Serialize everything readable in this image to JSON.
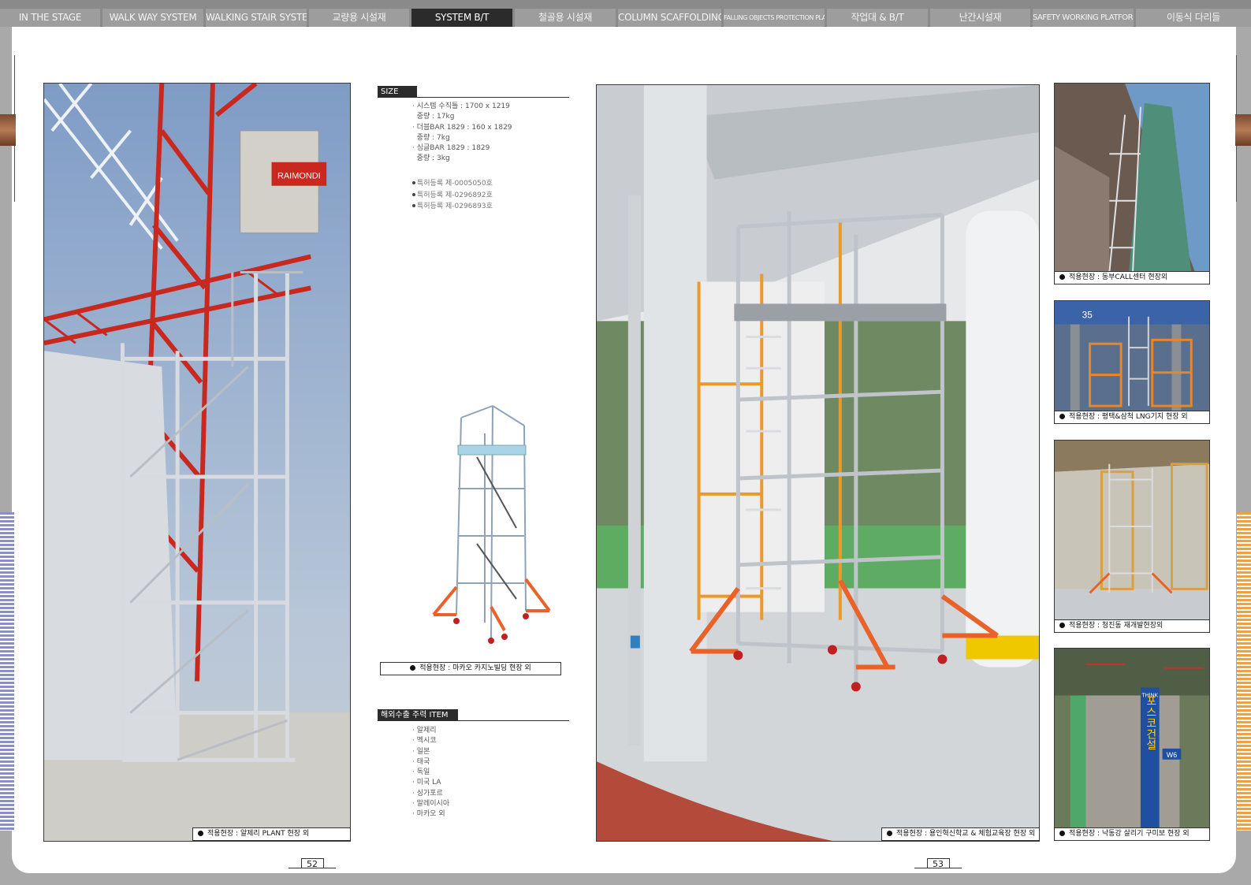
{
  "tabs": [
    {
      "label": "IN THE STAGE",
      "active": false
    },
    {
      "label": "WALK WAY SYSTEM",
      "active": false
    },
    {
      "label": "WALKING STAIR SYSTEM",
      "active": false
    },
    {
      "label": "교량용 시설재",
      "active": false
    },
    {
      "label": "SYSTEM B/T",
      "active": true
    },
    {
      "label": "철골용 시설재",
      "active": false
    },
    {
      "label": "COLUMN SCAFFOLDING",
      "active": false
    },
    {
      "label": "FALLING OBJECTS PROTECTION PLATFORM",
      "active": false
    },
    {
      "label": "작업대 & B/T",
      "active": false
    },
    {
      "label": "난간시설재",
      "active": false
    },
    {
      "label": "SAFETY WORKING PLATFORM",
      "active": false
    },
    {
      "label": "이동식 다리들",
      "active": false
    }
  ],
  "left_page": {
    "main_photo": {
      "icon": "scaffold-tower-crane-photo",
      "caption": "적용현장 : 알제리 PLANT 현장 외"
    },
    "size_section": {
      "heading": "SIZE",
      "lines": [
        "· 시스템 수직틀 : 1700 x 1219",
        "  중량 : 17kg",
        "· 더블BAR 1829 : 160 x 1829",
        "  중량 : 7kg",
        "· 싱글BAR 1829 : 1829",
        "  중량 : 3kg"
      ],
      "patents": [
        "특허등록 제-0005050호",
        "특허등록 제-0296892호",
        "특허등록 제-0296893호"
      ]
    },
    "product_photo": {
      "icon": "mobile-scaffold-tower-photo",
      "caption": "적용현장 : 마카오 카지노빌딩 현장 외"
    },
    "export_section": {
      "heading": "해외수출 주력 ITEM",
      "items": [
        "· 알제리",
        "· 멕시코",
        "· 일본",
        "· 태국",
        "· 독일",
        "· 미국 LA",
        "· 싱가포르",
        "· 말레이시아",
        "· 마카오 외"
      ]
    },
    "page_number": "52"
  },
  "right_page": {
    "main_photo": {
      "icon": "scaffold-under-bridge-photo",
      "caption": "적용현장 : 용인혁신학교 & 체험교육장 현장 외"
    },
    "side_photos": [
      {
        "icon": "tall-scaffold-net-photo",
        "caption": "적용현장 : 동부CALL센터 현장외"
      },
      {
        "icon": "lng-base-scaffold-photo",
        "caption": "적용현장 : 평택&삼척 LNG기지 현장 외"
      },
      {
        "icon": "indoor-scaffold-photo",
        "caption": "적용현장 : 청진동 재개발현장외"
      },
      {
        "icon": "posco-pier-scaffold-photo",
        "caption": "적용현장 : 낙동강 살리기 구미보 현장 외"
      }
    ],
    "page_number": "53"
  },
  "photo_texts": {
    "crane_brand": "RAIMONDI",
    "banner_top": "THINK",
    "banner_main": "포스코건설",
    "pier_label": "W6",
    "column_number": "35"
  },
  "colors": {
    "active_tab": "#2b2b2b",
    "tab": "#9d9d9d",
    "left_stripe": "#8a8fc8",
    "right_stripe": "#f0a040",
    "crane_red": "#c8281e",
    "scaffold_orange": "#e8622a"
  }
}
